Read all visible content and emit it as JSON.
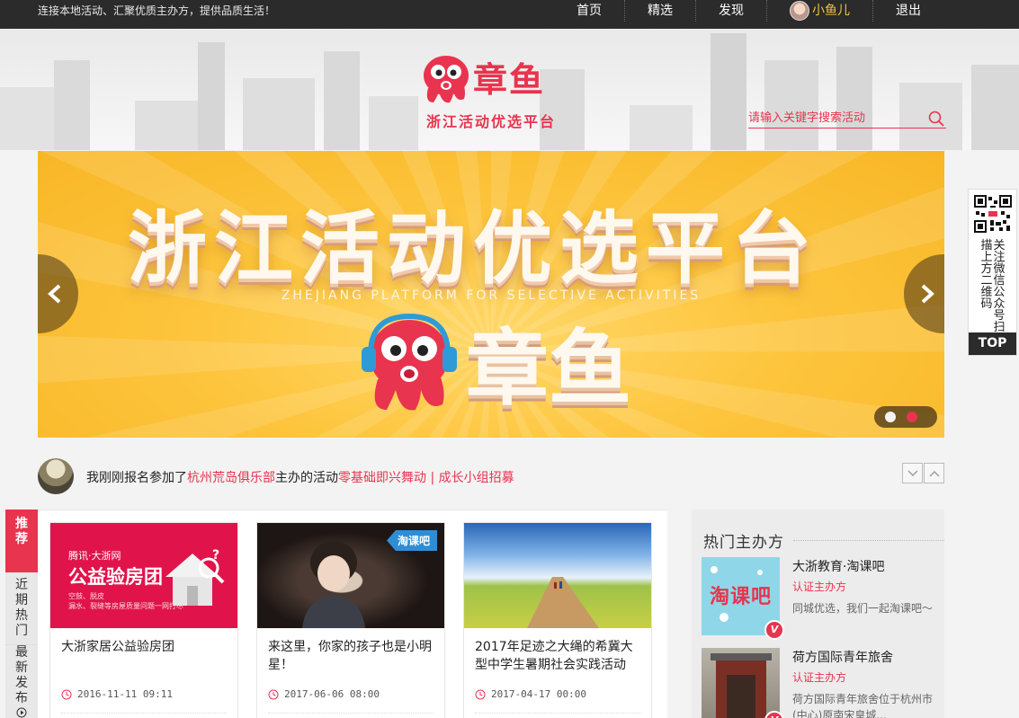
{
  "topbar": {
    "slogan": "连接本地活动、汇聚优质主办方，提供品质生活！",
    "nav": [
      {
        "label": "首页"
      },
      {
        "label": "精选"
      },
      {
        "label": "发现"
      }
    ],
    "user_name": "小鱼儿",
    "logout": "退出"
  },
  "header": {
    "logo_text": "章鱼",
    "logo_sub": "浙江活动优选平台",
    "search_placeholder": "请输入关键字搜索活动"
  },
  "banner": {
    "title": "浙江活动优选平台",
    "subtitle": "ZHEJIANG PLATFORM FOR SELECTIVE ACTIVITIES",
    "brand": "章鱼",
    "active_slide": 2,
    "slide_count": 2
  },
  "sidebar_qr": {
    "text_col1": [
      "关",
      "注",
      "微",
      "信",
      "公",
      "众",
      "号"
    ],
    "text_col2": [
      "扫",
      "描",
      "上",
      "方",
      "二",
      "维",
      "码"
    ],
    "top_label": "TOP"
  },
  "ticker": {
    "prefix": "我刚刚报名参加了",
    "club": "杭州荒岛俱乐部",
    "middle": "主办的活动",
    "event": "零基础即兴舞动 | 成长小组招募"
  },
  "tabs": {
    "recommend": [
      "推",
      "荐"
    ],
    "recent_hot": [
      "近",
      "期",
      "热",
      "门"
    ],
    "latest": [
      "最",
      "新",
      "发",
      "布"
    ]
  },
  "cards": [
    {
      "title": "大浙家居公益验房团",
      "date": "2016-11-11 09:11",
      "thumb_line1": "腾讯·大浙网",
      "thumb_big": "公益验房团",
      "thumb_small": "空鼓、脱皮\n漏水、裂缝等房屋质量问题一网打尽"
    },
    {
      "title": "来这里，你家的孩子也是小明星！",
      "date": "2017-06-06 08:00",
      "tag": "淘课吧"
    },
    {
      "title": "2017年足迹之大绳的希冀大型中学生暑期社会实践活动",
      "date": "2017-04-17 00:00"
    }
  ],
  "hot": {
    "title": "热门主办方",
    "orgs": [
      {
        "name": "大浙教育·淘课吧",
        "cert": "认证主办方",
        "desc": "同城优选，我们一起淘课吧～",
        "logo_text": "淘课吧"
      },
      {
        "name": "荷方国际青年旅舍",
        "cert": "认证主办方",
        "desc": "荷方国际青年旅舍位于杭州市(中心)原南宋皇城..."
      }
    ]
  },
  "colors": {
    "accent": "#e8344e",
    "topbar": "#2b2b2b",
    "banner": "#fdc53d",
    "user_name": "#f5c342"
  }
}
